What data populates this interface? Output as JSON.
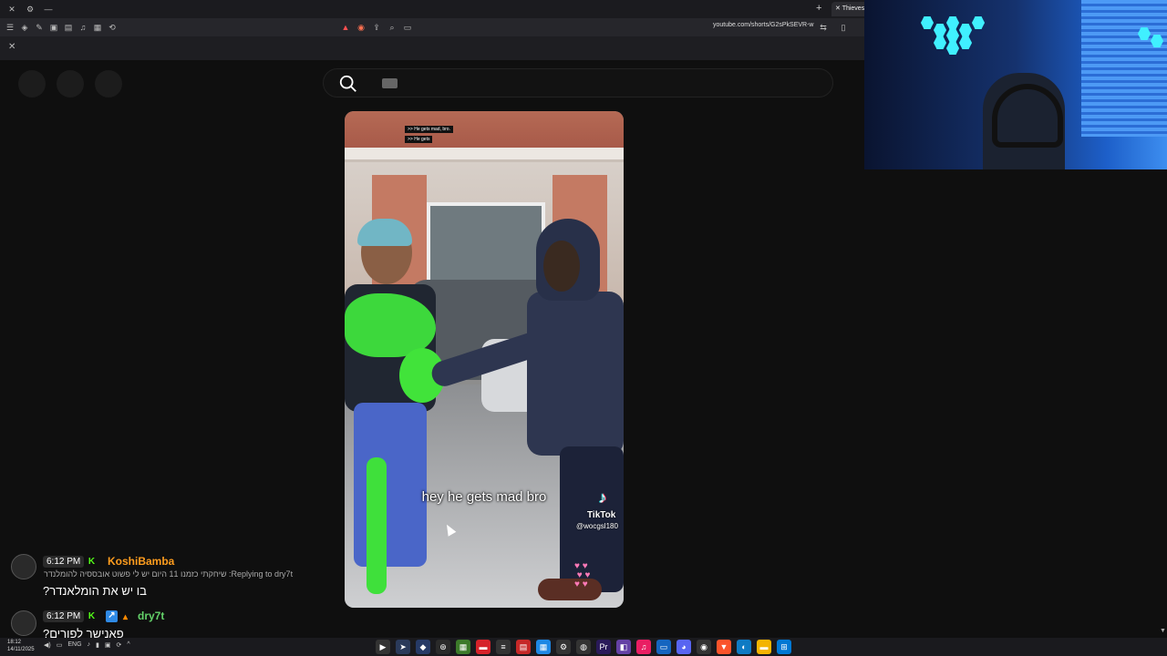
{
  "browser": {
    "active_tab_title": "Thieves",
    "url": "youtube.com/shorts/G2sPkSEVR-w"
  },
  "video": {
    "top_caption_1": ">> He gets mad, bro.",
    "top_caption_2": ">> He gets",
    "caption": "hey he gets mad bro",
    "tiktok_brand": "TikTok",
    "tiktok_handle": "@wocgsl180"
  },
  "chat": {
    "messages": [
      {
        "time": "6:12 PM",
        "username": "KoshiBamba",
        "replying_to": "שיחקתי כזמנו 11 היום יש לי פשוט אובססיה להומלנדר :Replying to dry7t",
        "text": "?בו יש את הומלאנדר"
      },
      {
        "time": "6:12 PM",
        "username": "dry7t",
        "text": "?פאנישר לפורים"
      }
    ]
  },
  "taskbar": {
    "time": "18:12",
    "date": "14/11/2025",
    "lang": "ENG"
  },
  "icons": [
    "search-icon",
    "keyboard-icon",
    "tiktok-icon",
    "close-icon",
    "plus-icon"
  ],
  "colors": {
    "username_orange": "#ff9d1e",
    "username_green": "#64d26a",
    "badge_green": "#53fc18",
    "webcam_accent": "#40f0ff"
  }
}
